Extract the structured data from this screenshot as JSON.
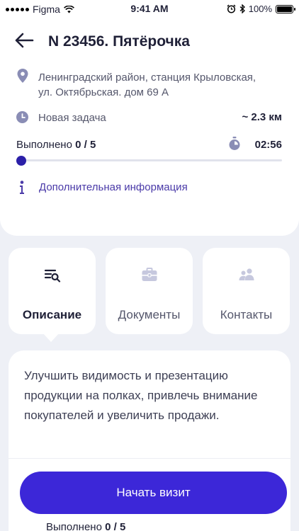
{
  "status_bar": {
    "carrier": "Figma",
    "time": "9:41 AM",
    "battery": "100%"
  },
  "header": {
    "title": "N 23456. Пятёрочка"
  },
  "task": {
    "address_line1": "Ленинградский район, станция Крыловская,",
    "address_line2": "ул. Октябрьская. дом 69 А",
    "status": "Новая задача",
    "distance": "~ 2.3 км",
    "progress_prefix": "Выполнено",
    "progress_value": "0 / 5",
    "progress_fraction": 0,
    "timer": "02:56",
    "more_info": "Дополнительная информация"
  },
  "tabs": [
    {
      "label": "Описание",
      "icon": "list-search-icon",
      "active": true
    },
    {
      "label": "Документы",
      "icon": "briefcase-icon",
      "active": false
    },
    {
      "label": "Контакты",
      "icon": "people-icon",
      "active": false
    }
  ],
  "description": {
    "text": "Улучшить видимость и презентацию продукции на полках, привлечь внимание покупателей и увеличить продажи."
  },
  "actions": {
    "start_visit": "Начать визит",
    "bottom_progress_prefix": "Выполнено",
    "bottom_progress_value": "0 / 5"
  },
  "colors": {
    "accent": "#3c27d8",
    "progress": "#2b1fa8",
    "link": "#4a3aa8",
    "background": "#eef0f6"
  }
}
